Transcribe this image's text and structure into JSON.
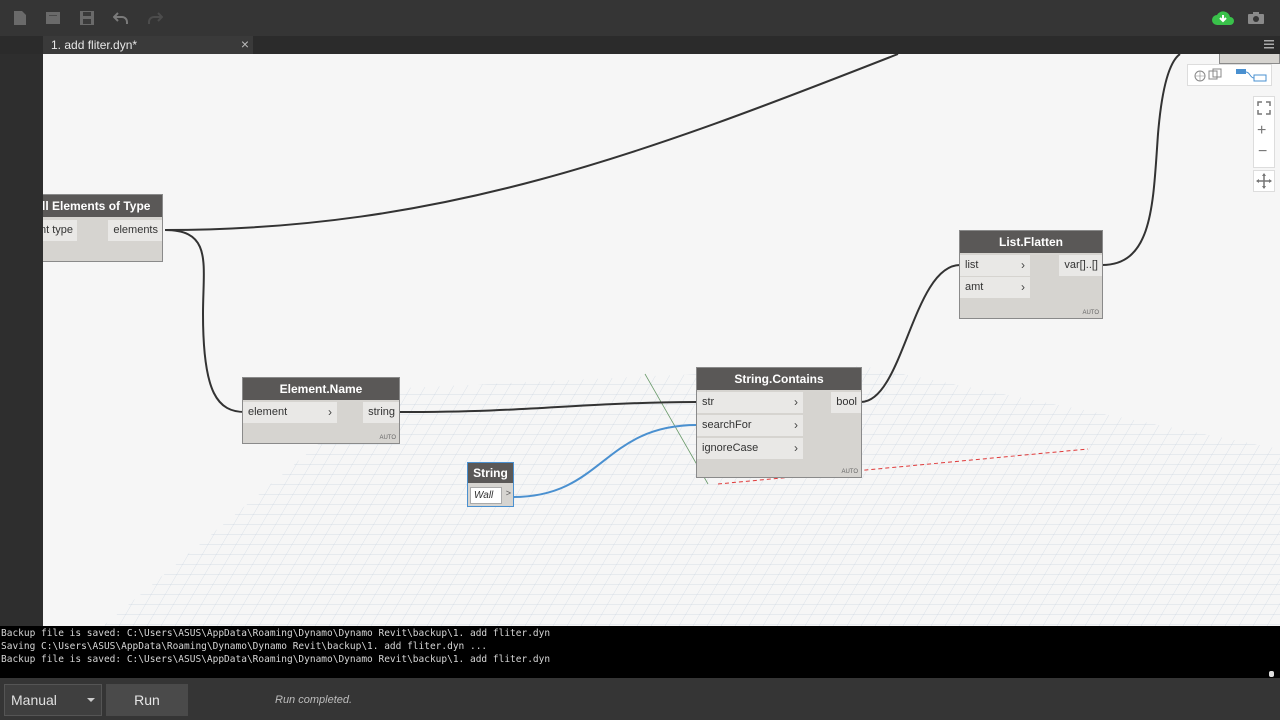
{
  "toolbar": {
    "new_icon": "new-file-icon",
    "open_icon": "open-icon",
    "save_icon": "save-icon",
    "undo_icon": "undo-icon",
    "redo_icon": "redo-icon",
    "cloud_icon": "cloud-download-icon",
    "camera_icon": "camera-icon"
  },
  "tab": {
    "label": "1. add fliter.dyn*",
    "close": "×"
  },
  "nodes": {
    "all_elements": {
      "title": "ll Elements of Type",
      "input_label": "nt type",
      "output_label": "elements"
    },
    "element_name": {
      "title": "Element.Name",
      "input_label": "element",
      "output_label": "string",
      "lacing": "AUTO"
    },
    "string_node": {
      "title": "String",
      "value": "Wall",
      "output_label": ">"
    },
    "string_contains": {
      "title": "String.Contains",
      "inputs": [
        "str",
        "searchFor",
        "ignoreCase"
      ],
      "output_label": "bool",
      "lacing": "AUTO"
    },
    "list_flatten": {
      "title": "List.Flatten",
      "inputs": [
        "list",
        "amt"
      ],
      "output_label": "var[]..[]",
      "lacing": "AUTO"
    }
  },
  "console": {
    "lines": [
      "Backup file is saved: C:\\Users\\ASUS\\AppData\\Roaming\\Dynamo\\Dynamo Revit\\backup\\1. add fliter.dyn",
      "Saving C:\\Users\\ASUS\\AppData\\Roaming\\Dynamo\\Dynamo Revit\\backup\\1. add fliter.dyn ...",
      "Backup file is saved: C:\\Users\\ASUS\\AppData\\Roaming\\Dynamo\\Dynamo Revit\\backup\\1. add fliter.dyn"
    ]
  },
  "bottom": {
    "run_mode": "Manual",
    "run_button": "Run",
    "status": "Run completed."
  },
  "colors": {
    "accent_cloud": "#39c14a",
    "wire": "#333333",
    "wire_selected": "#4a90d0",
    "node_header": "#5a5857"
  }
}
